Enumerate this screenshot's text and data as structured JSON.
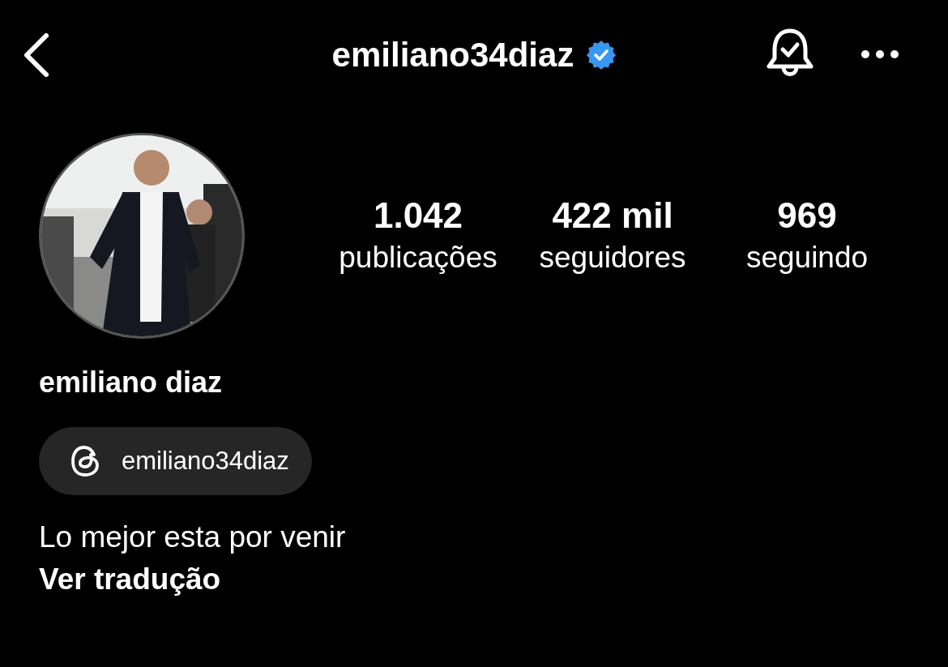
{
  "header": {
    "username": "emiliano34diaz",
    "verified": true
  },
  "profile": {
    "stats": [
      {
        "value": "1.042",
        "label": "publicações"
      },
      {
        "value": "422 mil",
        "label": "seguidores"
      },
      {
        "value": "969",
        "label": "seguindo"
      }
    ],
    "name": "emiliano diaz",
    "threads_handle": "emiliano34diaz",
    "bio": "Lo mejor esta por venir",
    "translate_link": "Ver tradução"
  }
}
